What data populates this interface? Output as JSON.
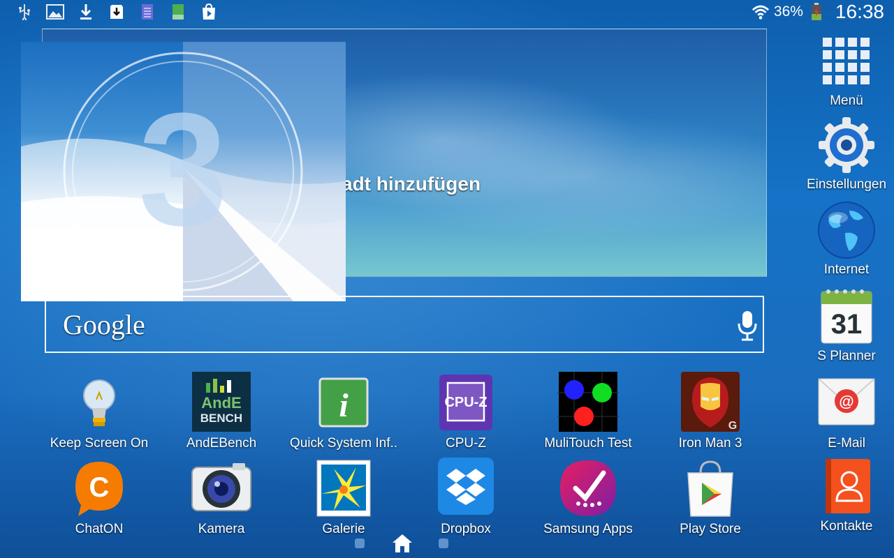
{
  "status_bar": {
    "notification_icons": [
      "usb-icon",
      "image-icon",
      "download-icon",
      "sd-card-download-icon",
      "notes-icon",
      "battery-small-icon",
      "play-store-notification-icon"
    ],
    "wifi_icon": "wifi-icon",
    "battery_percent": "36%",
    "battery_icon": "battery-charging-icon",
    "time": "16:38"
  },
  "weather_widget": {
    "text": "adt hinzufügen"
  },
  "overlay": {
    "countdown_number": "3"
  },
  "google_search": {
    "logo_text": "Google",
    "mic_icon": "microphone-icon"
  },
  "apps_row1": [
    {
      "label": "Keep Screen On",
      "icon": "lightbulb-icon"
    },
    {
      "label": "AndEBench",
      "icon": "andebench-icon"
    },
    {
      "label": "Quick System Inf..",
      "icon": "info-icon"
    },
    {
      "label": "CPU-Z",
      "icon": "cpu-z-icon"
    },
    {
      "label": "MuliTouch Test",
      "icon": "multitouch-icon"
    },
    {
      "label": "Iron Man 3",
      "icon": "iron-man-icon"
    }
  ],
  "apps_row2": [
    {
      "label": "ChatON",
      "icon": "chaton-icon"
    },
    {
      "label": "Kamera",
      "icon": "camera-icon"
    },
    {
      "label": "Galerie",
      "icon": "gallery-icon"
    },
    {
      "label": "Dropbox",
      "icon": "dropbox-icon"
    },
    {
      "label": "Samsung Apps",
      "icon": "samsung-apps-icon"
    },
    {
      "label": "Play Store",
      "icon": "play-store-icon"
    }
  ],
  "dock": [
    {
      "label": "Menü",
      "icon": "apps-grid-icon"
    },
    {
      "label": "Einstellungen",
      "icon": "settings-gear-icon"
    },
    {
      "label": "Internet",
      "icon": "globe-icon"
    },
    {
      "label": "S Planner",
      "icon": "calendar-icon",
      "day": "31"
    },
    {
      "label": "E-Mail",
      "icon": "email-icon"
    },
    {
      "label": "Kontakte",
      "icon": "contacts-icon"
    }
  ],
  "navigation": {
    "home_icon": "home-icon",
    "current_page": 2,
    "page_count": 3
  }
}
